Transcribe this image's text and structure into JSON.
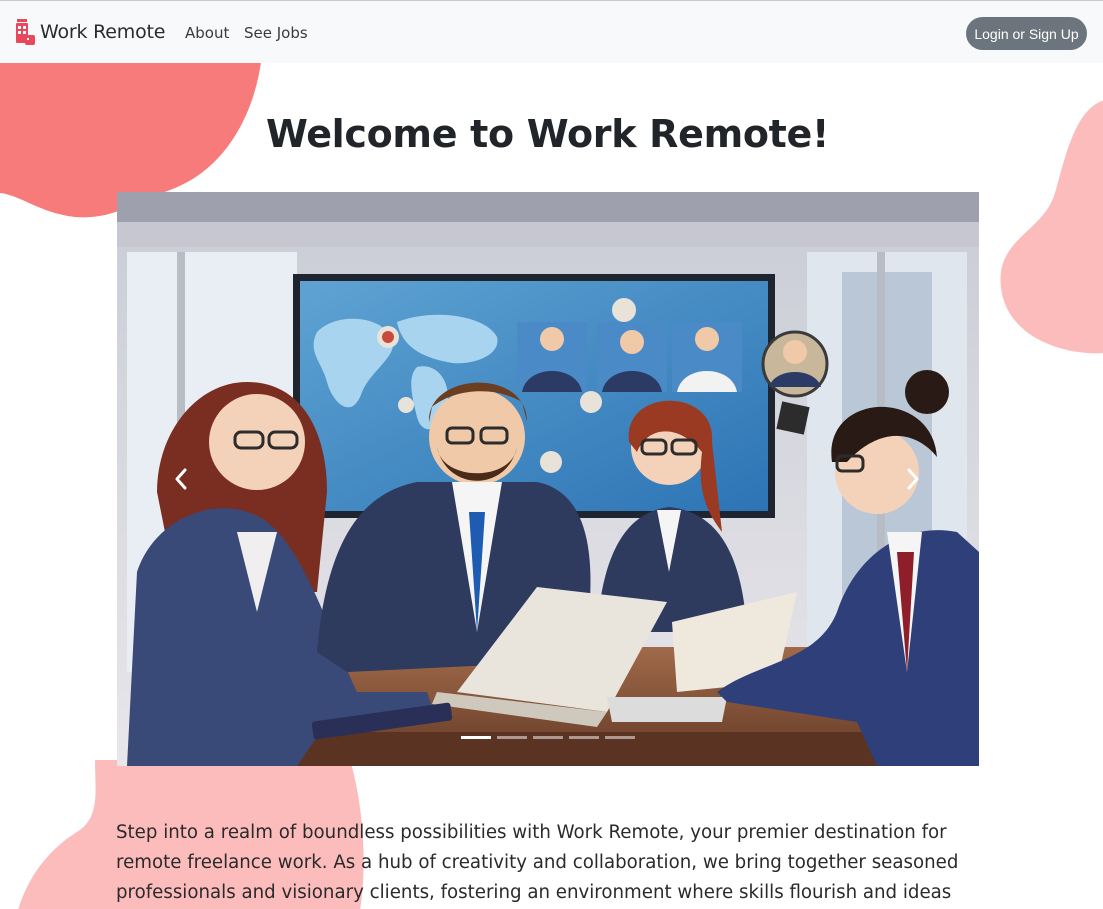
{
  "navbar": {
    "brand": "Work Remote",
    "links": [
      {
        "label": "About"
      },
      {
        "label": "See Jobs"
      }
    ],
    "login_label": "Login or Sign Up"
  },
  "hero": {
    "title": "Welcome to Work Remote!"
  },
  "carousel": {
    "slide_count": 5,
    "active_index": 0
  },
  "intro": {
    "text": "Step into a realm of boundless possibilities with Work Remote, your premier destination for remote freelance work. As a hub of creativity and collaboration, we bring together seasoned professionals and visionary clients, fostering an environment where skills flourish and ideas come"
  },
  "colors": {
    "blob_coral": "#f77b7b",
    "blob_pink": "#fdbcbc",
    "button_gray": "#6c757d",
    "navbar_bg": "#f8f9fa"
  },
  "icons": {
    "brand": "building-logo-icon",
    "prev": "chevron-left-icon",
    "next": "chevron-right-icon"
  }
}
